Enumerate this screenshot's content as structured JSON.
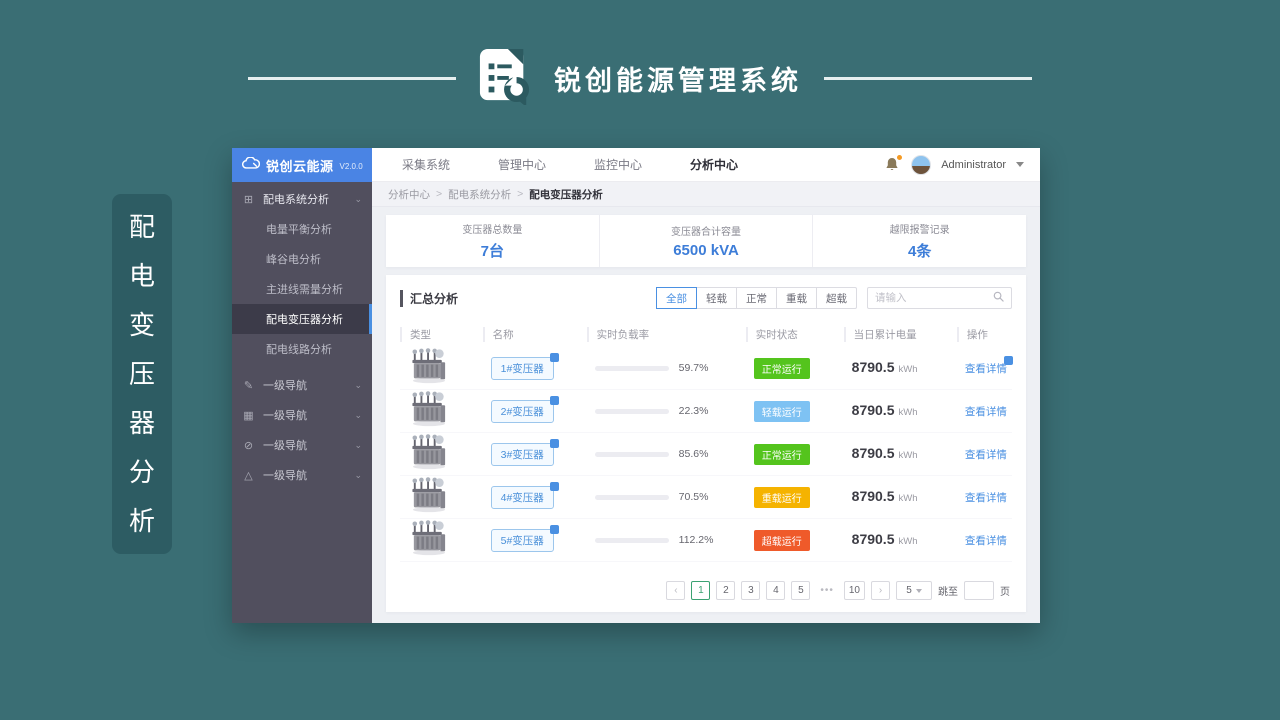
{
  "banner": {
    "title": "锐创能源管理系统"
  },
  "side_tag": {
    "chars": [
      "配",
      "电",
      "变",
      "压",
      "器",
      "分",
      "析"
    ]
  },
  "app": {
    "logo": {
      "name": "锐创云能源",
      "version": "V2.0.0"
    },
    "topnav": {
      "items": [
        {
          "label": "采集系统"
        },
        {
          "label": "管理中心"
        },
        {
          "label": "监控中心"
        },
        {
          "label": "分析中心",
          "active": true
        }
      ]
    },
    "user": {
      "name": "Administrator"
    },
    "sidebar": {
      "root": {
        "icon": "⊞",
        "label": "配电系统分析",
        "chevron": "⌄"
      },
      "children": [
        {
          "label": "电量平衡分析"
        },
        {
          "label": "峰谷电分析"
        },
        {
          "label": "主进线需量分析"
        },
        {
          "label": "配电变压器分析",
          "active": true
        },
        {
          "label": "配电线路分析"
        }
      ],
      "extras": [
        {
          "icon": "✎",
          "label": "一级导航",
          "chevron": "⌄"
        },
        {
          "icon": "▦",
          "label": "一级导航",
          "chevron": "⌄"
        },
        {
          "icon": "⊘",
          "label": "一级导航",
          "chevron": "⌄"
        },
        {
          "icon": "△",
          "label": "一级导航",
          "chevron": "⌄"
        }
      ]
    },
    "breadcrumb": {
      "separator": ">",
      "items": [
        {
          "label": "分析中心"
        },
        {
          "label": "配电系统分析",
          "sep": true
        },
        {
          "label": "配电变压器分析",
          "sep": true,
          "current": true
        }
      ]
    },
    "stats": [
      {
        "label": "变压器总数量",
        "value": "7台"
      },
      {
        "label": "变压器合计容量",
        "value": "6500 kVA"
      },
      {
        "label": "越限报警记录",
        "value": "4条"
      }
    ],
    "summary": {
      "title": "汇总分析",
      "filters": [
        {
          "label": "全部",
          "active": true
        },
        {
          "label": "轻载"
        },
        {
          "label": "正常"
        },
        {
          "label": "重载"
        },
        {
          "label": "超载"
        }
      ],
      "search_placeholder": "请输入"
    },
    "table": {
      "headers": [
        "类型",
        "名称",
        "实时负载率",
        "实时状态",
        "当日累计电量",
        "操作"
      ],
      "rows": [
        {
          "name": "1#变压器",
          "load_label": "59.7%",
          "load_value": 59.7,
          "status": "正常运行",
          "status_type": "normal",
          "energy": "8790.5",
          "unit": "kWh",
          "action": "查看详情",
          "action_badge": true
        },
        {
          "name": "2#变压器",
          "load_label": "22.3%",
          "load_value": 22.3,
          "status": "轻载运行",
          "status_type": "light",
          "energy": "8790.5",
          "unit": "kWh",
          "action": "查看详情"
        },
        {
          "name": "3#变压器",
          "load_label": "85.6%",
          "load_value": 85.6,
          "status": "正常运行",
          "status_type": "normal",
          "energy": "8790.5",
          "unit": "kWh",
          "action": "查看详情"
        },
        {
          "name": "4#变压器",
          "load_label": "70.5%",
          "load_value": 70.5,
          "status": "重载运行",
          "status_type": "heavy",
          "energy": "8790.5",
          "unit": "kWh",
          "action": "查看详情"
        },
        {
          "name": "5#变压器",
          "load_label": "112.2%",
          "load_value": 112.2,
          "status": "超载运行",
          "status_type": "over",
          "energy": "8790.5",
          "unit": "kWh",
          "action": "查看详情"
        }
      ]
    },
    "pagination": {
      "prev": "‹",
      "next": "›",
      "pages": [
        {
          "label": "1",
          "active": true
        },
        {
          "label": "2"
        },
        {
          "label": "3"
        },
        {
          "label": "4"
        },
        {
          "label": "5"
        },
        {
          "label": "•••",
          "plain": true
        },
        {
          "label": "10"
        }
      ],
      "page_size": "5",
      "jump_label": "跳至",
      "page_unit": "页"
    }
  },
  "colors": {
    "background_teal": "#3a6e74",
    "accent_blue": "#4a90e2",
    "status_normal": "#54c41d",
    "status_light": "#7ec2f3",
    "status_heavy": "#f5b300",
    "status_over": "#ef5a2a",
    "pagination_active": "#3ba272"
  }
}
